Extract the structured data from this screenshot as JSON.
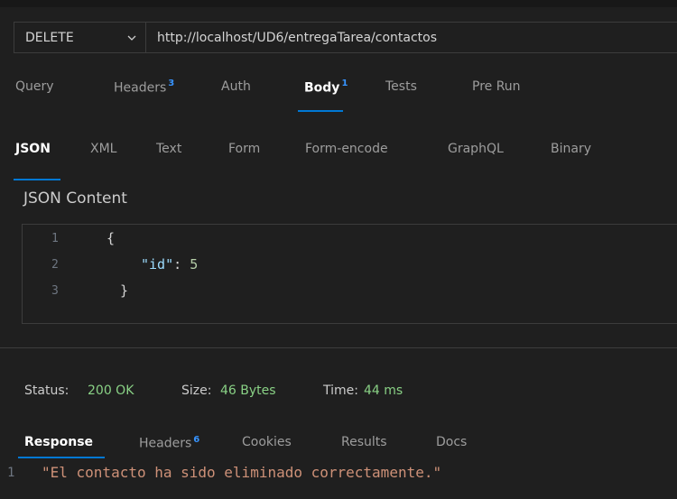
{
  "request": {
    "method": "DELETE",
    "url": "http://localhost/UD6/entregaTarea/contactos"
  },
  "request_tabs": [
    {
      "label": "Query",
      "badge": "",
      "active": false
    },
    {
      "label": "Headers",
      "badge": "3",
      "active": false
    },
    {
      "label": "Auth",
      "badge": "",
      "active": false
    },
    {
      "label": "Body",
      "badge": "1",
      "active": true
    },
    {
      "label": "Tests",
      "badge": "",
      "active": false
    },
    {
      "label": "Pre Run",
      "badge": "",
      "active": false
    }
  ],
  "body_tabs": [
    {
      "label": "JSON",
      "active": true
    },
    {
      "label": "XML",
      "active": false
    },
    {
      "label": "Text",
      "active": false
    },
    {
      "label": "Form",
      "active": false
    },
    {
      "label": "Form-encode",
      "active": false
    },
    {
      "label": "GraphQL",
      "active": false
    },
    {
      "label": "Binary",
      "active": false
    }
  ],
  "json_content": {
    "title": "JSON Content",
    "lines": [
      {
        "number": "1",
        "text": "{"
      },
      {
        "number": "2",
        "key": "\"id\"",
        "sep": ": ",
        "value": "5"
      },
      {
        "number": "3",
        "text": "}"
      }
    ]
  },
  "status": {
    "status_label": "Status:",
    "status_value": "200 OK",
    "size_label": "Size:",
    "size_value": "46 Bytes",
    "time_label": "Time:",
    "time_value": "44 ms"
  },
  "response_tabs": [
    {
      "label": "Response",
      "badge": "",
      "active": true
    },
    {
      "label": "Headers",
      "badge": "6",
      "active": false
    },
    {
      "label": "Cookies",
      "badge": "",
      "active": false
    },
    {
      "label": "Results",
      "badge": "",
      "active": false
    },
    {
      "label": "Docs",
      "badge": "",
      "active": false
    }
  ],
  "response": {
    "line_number": "1",
    "text": "\"El contacto ha sido eliminado correctamente.\""
  },
  "colors": {
    "accent": "#0078d4",
    "badge": "#3794ff",
    "success": "#89d185",
    "string": "#ce9178",
    "key": "#9cdcfe",
    "number": "#b5cea8"
  }
}
